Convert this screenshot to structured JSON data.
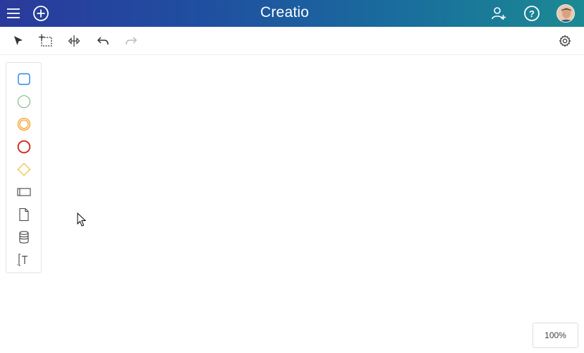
{
  "app": {
    "logo_text": "Creatio"
  },
  "header": {
    "icons": [
      "menu-icon",
      "add-icon",
      "invite-user-icon",
      "help-icon",
      "user-avatar"
    ]
  },
  "toolbar": {
    "tools": [
      "select-icon",
      "lasso-select-icon",
      "space-tool-icon",
      "undo-icon",
      "redo-icon",
      "settings-icon"
    ]
  },
  "palette": {
    "items": [
      "task-icon",
      "start-event-icon",
      "intermediate-event-icon",
      "end-event-icon",
      "gateway-icon",
      "pool-icon",
      "data-object-icon",
      "data-store-icon",
      "text-annotation-icon"
    ]
  },
  "colors": {
    "task": "#1e88e5",
    "start_event": "#7cb77c",
    "intermediate_event": "#f0a020",
    "end_event": "#d0362a",
    "gateway": "#f3c244"
  },
  "zoom": {
    "label": "100%"
  }
}
